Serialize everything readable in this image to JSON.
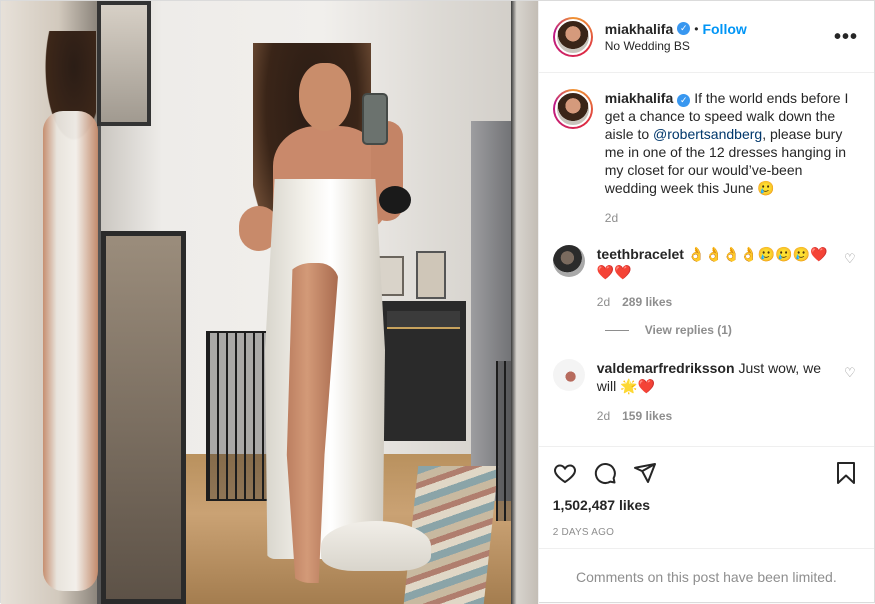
{
  "post": {
    "photo_icon": "mirror-selfie-photo"
  },
  "header": {
    "username": "miakhalifa",
    "verified_glyph": "✓",
    "separator": "•",
    "follow_label": "Follow",
    "subtitle": "No Wedding BS",
    "more_icon": "more-options-icon",
    "more_glyph": "•••"
  },
  "caption": {
    "username": "miakhalifa",
    "verified_glyph": "✓",
    "text_before": "If the world ends before I get a chance to speed walk down the aisle to ",
    "mention": "@robertsandberg",
    "text_after": ", please bury me in one of the 12 dresses hanging in my closet for our would’ve-been wedding week this June 🥲",
    "time": "2d"
  },
  "comments": [
    {
      "username": "teethbracelet",
      "text": "👌👌👌👌🥲🥲🥲❤️❤️❤️",
      "time": "2d",
      "likes": "289 likes"
    },
    {
      "username": "valdemarfredriksson",
      "text": "Just wow, we will 🌟❤️",
      "time": "2d",
      "likes": "159 likes"
    }
  ],
  "view_replies": "View replies (1)",
  "actions": {
    "like_icon": "heart-icon",
    "comment_icon": "comment-icon",
    "share_icon": "share-icon",
    "save_icon": "bookmark-icon",
    "likes_count": "1,502,487 likes",
    "posted": "2 days ago"
  },
  "footer": {
    "limited_text": "Comments on this post have been limited."
  },
  "colors": {
    "link": "#00376b",
    "follow": "#0095f6",
    "verified": "#3897f0",
    "muted": "#8e8e8e"
  }
}
